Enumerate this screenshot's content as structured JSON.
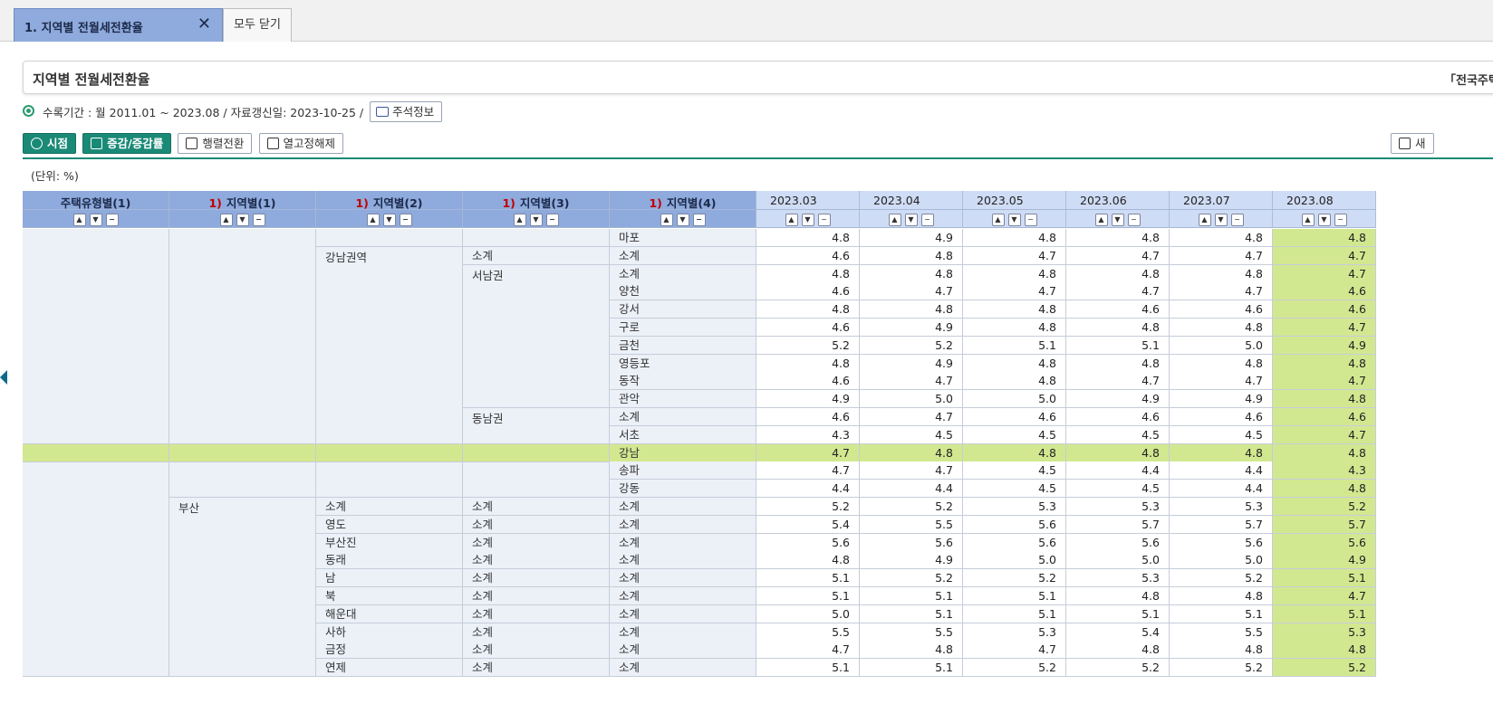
{
  "tabs": {
    "active_label": "1. 지역별 전월세전환율",
    "close_all_label": "모두 닫기"
  },
  "title": "지역별 전월세전환율",
  "source": "「전국주택",
  "info": {
    "period_text": "수록기간 : 월 2011.01 ~ 2023.08 / 자료갱신일: 2023-10-25 /",
    "comment_button": "주석정보"
  },
  "toolbar": {
    "time_button": "시점",
    "change_button": "증감/증감률",
    "pivot_button": "행렬전환",
    "release_button": "열고정해제",
    "right_button": "새"
  },
  "unit": "(단위: %)",
  "table": {
    "dim_headers": [
      {
        "num": "",
        "label": "주택유형별(1)"
      },
      {
        "num": "1)",
        "label": "지역별(1)"
      },
      {
        "num": "1)",
        "label": "지역별(2)"
      },
      {
        "num": "1)",
        "label": "지역별(3)"
      },
      {
        "num": "1)",
        "label": "지역별(4)"
      }
    ],
    "date_headers": [
      "2023.03",
      "2023.04",
      "2023.05",
      "2023.06",
      "2023.07",
      "2023.08"
    ],
    "sort_symbols": {
      "up": "▲",
      "down": "▼",
      "collapse": "−"
    },
    "merged_labels": {
      "gangnam_region": "강남권역",
      "southwest": "서남권",
      "southeast": "동남권",
      "busan": "부산"
    },
    "rows": [
      {
        "c3": "",
        "c4": "",
        "c5": "마포",
        "v": [
          "4.8",
          "4.9",
          "4.8",
          "4.8",
          "4.8",
          "4.8"
        ]
      },
      {
        "c3": "",
        "c4": "소계",
        "c5": "소계",
        "v": [
          "4.6",
          "4.8",
          "4.7",
          "4.7",
          "4.7",
          "4.7"
        ]
      },
      {
        "c3": "",
        "c4": "",
        "c5": "소계",
        "v": [
          "4.8",
          "4.8",
          "4.8",
          "4.8",
          "4.8",
          "4.7"
        ]
      },
      {
        "c3": "",
        "c4": "",
        "c5": "양천",
        "v": [
          "4.6",
          "4.7",
          "4.7",
          "4.7",
          "4.7",
          "4.6"
        ]
      },
      {
        "c3": "",
        "c4": "",
        "c5": "강서",
        "v": [
          "4.8",
          "4.8",
          "4.8",
          "4.6",
          "4.6",
          "4.6"
        ]
      },
      {
        "c3": "",
        "c4": "",
        "c5": "구로",
        "v": [
          "4.6",
          "4.9",
          "4.8",
          "4.8",
          "4.8",
          "4.7"
        ]
      },
      {
        "c3": "",
        "c4": "",
        "c5": "금천",
        "v": [
          "5.2",
          "5.2",
          "5.1",
          "5.1",
          "5.0",
          "4.9"
        ]
      },
      {
        "c3": "",
        "c4": "",
        "c5": "영등포",
        "v": [
          "4.8",
          "4.9",
          "4.8",
          "4.8",
          "4.8",
          "4.8"
        ]
      },
      {
        "c3": "",
        "c4": "",
        "c5": "동작",
        "v": [
          "4.6",
          "4.7",
          "4.8",
          "4.7",
          "4.7",
          "4.7"
        ]
      },
      {
        "c3": "",
        "c4": "",
        "c5": "관악",
        "v": [
          "4.9",
          "5.0",
          "5.0",
          "4.9",
          "4.9",
          "4.8"
        ]
      },
      {
        "c3": "",
        "c4": "",
        "c5": "소계",
        "v": [
          "4.6",
          "4.7",
          "4.6",
          "4.6",
          "4.6",
          "4.6"
        ]
      },
      {
        "c3": "",
        "c4": "",
        "c5": "서초",
        "v": [
          "4.3",
          "4.5",
          "4.5",
          "4.5",
          "4.5",
          "4.7"
        ]
      },
      {
        "c3": "",
        "c4": "",
        "c5": "강남",
        "v": [
          "4.7",
          "4.8",
          "4.8",
          "4.8",
          "4.8",
          "4.8"
        ]
      },
      {
        "c3": "",
        "c4": "",
        "c5": "송파",
        "v": [
          "4.7",
          "4.7",
          "4.5",
          "4.4",
          "4.4",
          "4.3"
        ]
      },
      {
        "c3": "",
        "c4": "",
        "c5": "강동",
        "v": [
          "4.4",
          "4.4",
          "4.5",
          "4.5",
          "4.4",
          "4.8"
        ]
      },
      {
        "c3": "소계",
        "c4": "소계",
        "c5": "소계",
        "v": [
          "5.2",
          "5.2",
          "5.3",
          "5.3",
          "5.3",
          "5.2"
        ]
      },
      {
        "c3": "영도",
        "c4": "소계",
        "c5": "소계",
        "v": [
          "5.4",
          "5.5",
          "5.6",
          "5.7",
          "5.7",
          "5.7"
        ]
      },
      {
        "c3": "부산진",
        "c4": "소계",
        "c5": "소계",
        "v": [
          "5.6",
          "5.6",
          "5.6",
          "5.6",
          "5.6",
          "5.6"
        ]
      },
      {
        "c3": "동래",
        "c4": "소계",
        "c5": "소계",
        "v": [
          "4.8",
          "4.9",
          "5.0",
          "5.0",
          "5.0",
          "4.9"
        ]
      },
      {
        "c3": "남",
        "c4": "소계",
        "c5": "소계",
        "v": [
          "5.1",
          "5.2",
          "5.2",
          "5.3",
          "5.2",
          "5.1"
        ]
      },
      {
        "c3": "북",
        "c4": "소계",
        "c5": "소계",
        "v": [
          "5.1",
          "5.1",
          "5.1",
          "4.8",
          "4.8",
          "4.7"
        ]
      },
      {
        "c3": "해운대",
        "c4": "소계",
        "c5": "소계",
        "v": [
          "5.0",
          "5.1",
          "5.1",
          "5.1",
          "5.1",
          "5.1"
        ]
      },
      {
        "c3": "사하",
        "c4": "소계",
        "c5": "소계",
        "v": [
          "5.5",
          "5.5",
          "5.3",
          "5.4",
          "5.5",
          "5.3"
        ]
      },
      {
        "c3": "금정",
        "c4": "소계",
        "c5": "소계",
        "v": [
          "4.7",
          "4.8",
          "4.7",
          "4.8",
          "4.8",
          "4.8"
        ]
      },
      {
        "c3": "연제",
        "c4": "소계",
        "c5": "소계",
        "v": [
          "5.1",
          "5.1",
          "5.2",
          "5.2",
          "5.2",
          "5.2"
        ]
      }
    ]
  },
  "colors": {
    "header_blue": "#8faadc",
    "date_header": "#cfdcf5",
    "label_cell": "#ecf1f8",
    "highlight": "#d2e890",
    "accent_green": "#1a8a76",
    "red_marker": "#c00000"
  }
}
